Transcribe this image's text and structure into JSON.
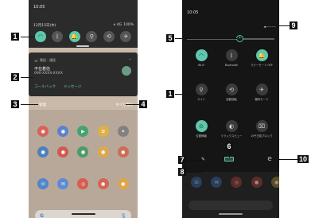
{
  "left": {
    "clock": "10:05",
    "date": "12月15日(木)",
    "status": [
      "⌀ 4G",
      "100%"
    ],
    "quick_settings": [
      {
        "icon": "wifi-icon",
        "glyph": "◠",
        "on": true
      },
      {
        "icon": "bluetooth-icon",
        "glyph": "ᛒ",
        "on": false
      },
      {
        "icon": "bell-icon",
        "glyph": "🔔",
        "on": true
      },
      {
        "icon": "flashlight-icon",
        "glyph": "⚲",
        "on": false
      },
      {
        "icon": "rotate-icon",
        "glyph": "⟲",
        "on": false
      },
      {
        "icon": "airplane-icon",
        "glyph": "✈",
        "on": false
      }
    ],
    "notification": {
      "app": "電話・通話",
      "title": "不在着信",
      "number": "090-XXXX-XXXX",
      "actions": [
        "コールバック",
        "メッセージ"
      ]
    },
    "manage_label": "管理",
    "clear_all_label": "すべて消去"
  },
  "right": {
    "clock": "10:05",
    "status": "◢ ▭▭▭",
    "tiles": [
      {
        "label": "Wi-Fi",
        "glyph": "◠",
        "on": true
      },
      {
        "label": "Bluetooth",
        "glyph": "ᛒ",
        "on": false
      },
      {
        "label": "マナーモード OFF",
        "glyph": "🔔",
        "on": true
      },
      {
        "label": "ライト",
        "glyph": "⚲",
        "on": false
      },
      {
        "label": "自動回転",
        "glyph": "⟲",
        "on": false
      },
      {
        "label": "機内モード",
        "glyph": "✈",
        "on": false
      },
      {
        "label": "位置情報",
        "glyph": "⊙",
        "on": true
      },
      {
        "label": "リラックスビュー",
        "glyph": "◐",
        "on": false
      },
      {
        "label": "のぞき見ブロック",
        "glyph": "⌧",
        "on": false
      }
    ]
  },
  "callouts": [
    "1",
    "2",
    "3",
    "4",
    "5",
    "6",
    "7",
    "8",
    "9",
    "10"
  ],
  "colors": {
    "accent": "#5ec7ac",
    "panel_dark": "#2b2b2b",
    "callout_bg": "#111111"
  }
}
